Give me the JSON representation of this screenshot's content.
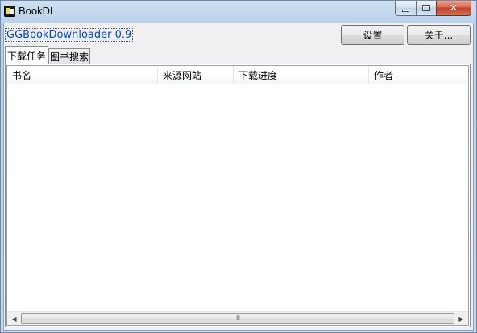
{
  "window": {
    "title": "BookDL"
  },
  "header": {
    "app_link": "GGBookDownloader 0.9",
    "settings_label": "设置",
    "about_label": "关于..."
  },
  "tabs": [
    {
      "label": "下载任务",
      "active": true
    },
    {
      "label": "图书搜索",
      "active": false
    }
  ],
  "table": {
    "columns": [
      "书名",
      "来源网站",
      "下载进度",
      "作者"
    ],
    "rows": []
  },
  "scrollbar": {
    "grip": "III"
  },
  "icons": {
    "app": "app-icon",
    "minimize": "minimize-icon",
    "maximize": "maximize-icon",
    "close": "close-icon",
    "scroll_left": "arrow-left-icon",
    "scroll_right": "arrow-right-icon"
  },
  "colors": {
    "link": "#0645c8",
    "close_button": "#c0422a",
    "frame": "#b9d1ea"
  }
}
